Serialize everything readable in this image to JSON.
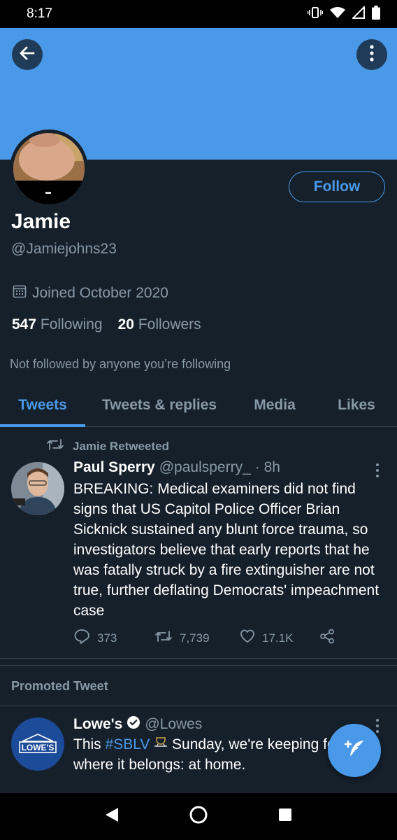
{
  "status_bar": {
    "time": "8:17"
  },
  "profile": {
    "follow_label": "Follow",
    "name": "Jamie",
    "handle": "@Jamiejohns23",
    "joined": "Joined October 2020",
    "following_count": "547",
    "following_label": "Following",
    "followers_count": "20",
    "followers_label": "Followers",
    "not_followed": "Not followed by anyone you’re following"
  },
  "tabs": [
    {
      "label": "Tweets",
      "active": true
    },
    {
      "label": "Tweets & replies",
      "active": false
    },
    {
      "label": "Media",
      "active": false
    },
    {
      "label": "Likes",
      "active": false
    }
  ],
  "tweet": {
    "retweeted_by": "Jamie Retweeted",
    "author": "Paul Sperry",
    "handle": "@paulsperry_",
    "time": "· 8h",
    "text": "BREAKING: Medical examiners did not find signs that US Capitol Police Officer Brian Sicknick sustained any blunt force trauma, so investigators believe that early reports that he was fatally struck by a fire extinguisher are not true, further deflating Democrats' impeachment case",
    "replies": "373",
    "retweets": "7,739",
    "likes": "17.1K"
  },
  "promoted": {
    "label": "Promoted Tweet",
    "author": "Lowe's",
    "handle": "@Lowes",
    "avatar_text": "LOWE'S",
    "text_before": "This ",
    "hashtag": "#SBLV",
    "text_after": " Sunday, we're keeping focus where it belongs: at home."
  },
  "colors": {
    "accent": "#4a99e9",
    "background": "#15202b",
    "muted": "#8899a6"
  }
}
